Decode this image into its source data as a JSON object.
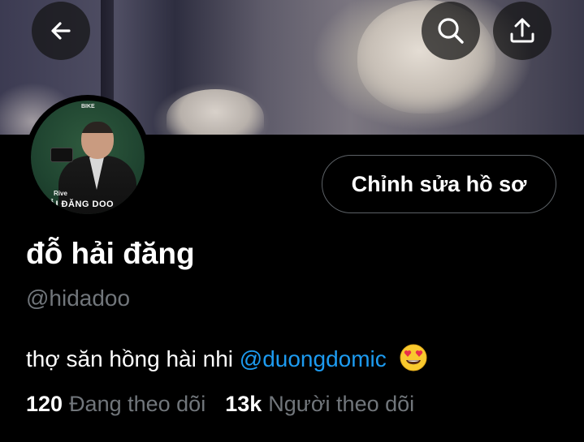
{
  "header": {
    "back_icon": "arrow-left-icon",
    "search_icon": "search-icon",
    "share_icon": "share-upload-icon"
  },
  "avatar": {
    "badge_top": "BIKE",
    "small_text": "Rive",
    "name_text": "ẢI ĐĂNG DOO"
  },
  "profile": {
    "edit_button": "Chỉnh sửa hồ sơ",
    "display_name": "đỗ hải đăng",
    "handle": "@hidadoo",
    "bio_text": "thợ săn hồng hài nhi",
    "bio_mention": "@duongdomic",
    "bio_emoji": "heart-eyes-emoji"
  },
  "stats": {
    "following_count": "120",
    "following_label": "Đang theo dõi",
    "followers_count": "13k",
    "followers_label": "Người theo dõi"
  },
  "colors": {
    "background": "#000000",
    "mention": "#1d9bf0",
    "secondary_text": "#71767b",
    "button_border": "#5c6166"
  }
}
